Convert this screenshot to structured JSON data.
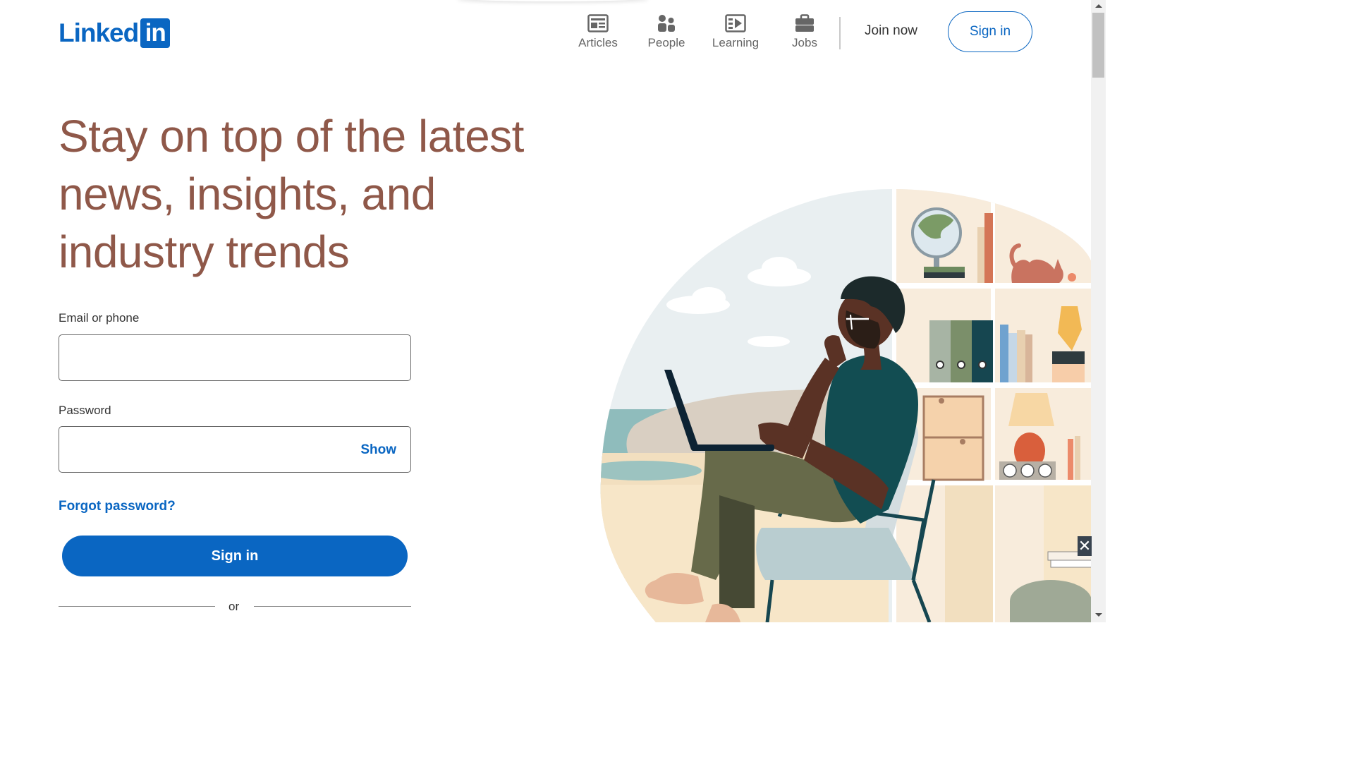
{
  "header": {
    "logo_word": "Linked",
    "logo_box": "in",
    "nav": [
      {
        "label": "Articles",
        "icon": "articles-icon"
      },
      {
        "label": "People",
        "icon": "people-icon"
      },
      {
        "label": "Learning",
        "icon": "learning-icon"
      },
      {
        "label": "Jobs",
        "icon": "jobs-icon"
      }
    ],
    "join_now": "Join now",
    "sign_in": "Sign in"
  },
  "hero": {
    "headline": "Stay on top of the latest news, insights, and industry trends"
  },
  "form": {
    "email_label": "Email or phone",
    "email_value": "",
    "password_label": "Password",
    "password_value": "",
    "show_label": "Show",
    "forgot_label": "Forgot password?",
    "signin_label": "Sign in",
    "or_label": "or"
  },
  "colors": {
    "brand_blue": "#0a66c2",
    "headline_brown": "#8f5849"
  }
}
